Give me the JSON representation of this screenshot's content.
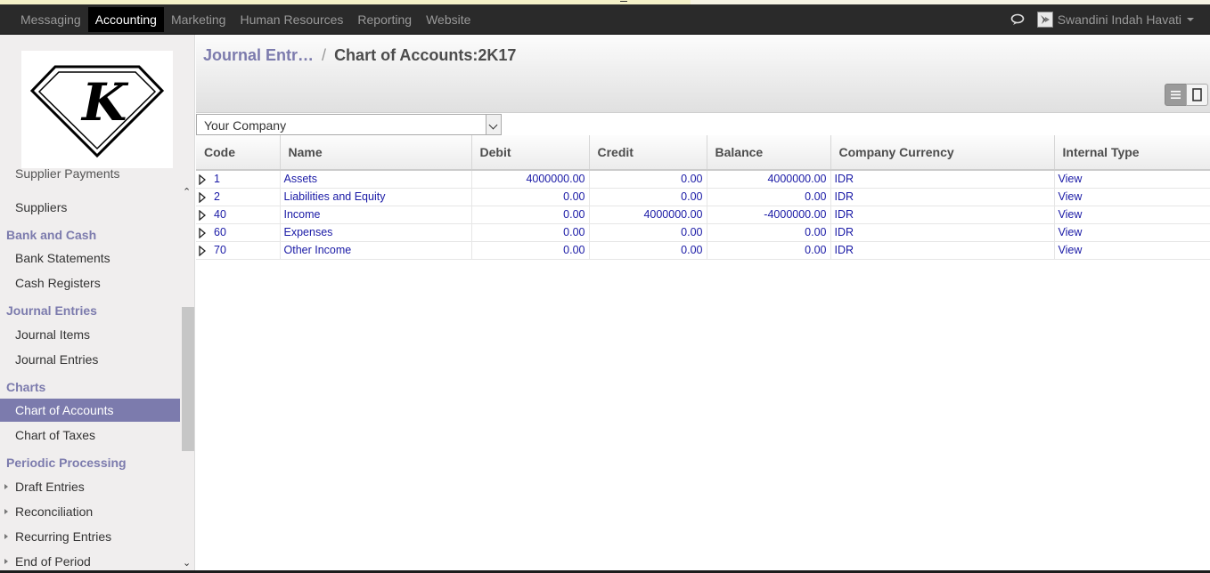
{
  "topmenu": [
    "Messaging",
    "Accounting",
    "Marketing",
    "Human Resources",
    "Reporting",
    "Website"
  ],
  "active_menu": "Accounting",
  "user": {
    "name": "Swandini Indah Havati"
  },
  "sidebar": {
    "partial_top": "Supplier Payments",
    "suppliers": "Suppliers",
    "bank_and_cash": "Bank and Cash",
    "bank_statements": "Bank Statements",
    "cash_registers": "Cash Registers",
    "journal_entries_cat": "Journal Entries",
    "journal_items": "Journal Items",
    "journal_entries": "Journal Entries",
    "charts": "Charts",
    "chart_of_accounts": "Chart of Accounts",
    "chart_of_taxes": "Chart of Taxes",
    "periodic_processing": "Periodic Processing",
    "draft_entries": "Draft Entries",
    "reconciliation": "Reconciliation",
    "recurring_entries": "Recurring Entries",
    "end_of_period": "End of Period"
  },
  "logo": {
    "letter": "K"
  },
  "breadcrumb": {
    "parent": "Journal Entr…",
    "separator": "/",
    "current": "Chart of Accounts:2K17"
  },
  "filter": {
    "company": "Your Company"
  },
  "table": {
    "columns": [
      "Code",
      "Name",
      "Debit",
      "Credit",
      "Balance",
      "Company Currency",
      "Internal Type"
    ],
    "rows": [
      {
        "code": "1",
        "name": "Assets",
        "debit": "4000000.00",
        "credit": "0.00",
        "balance": "4000000.00",
        "currency": "IDR",
        "type": "View"
      },
      {
        "code": "2",
        "name": "Liabilities and Equity",
        "debit": "0.00",
        "credit": "0.00",
        "balance": "0.00",
        "currency": "IDR",
        "type": "View"
      },
      {
        "code": "40",
        "name": "Income",
        "debit": "0.00",
        "credit": "4000000.00",
        "balance": "-4000000.00",
        "currency": "IDR",
        "type": "View"
      },
      {
        "code": "60",
        "name": "Expenses",
        "debit": "0.00",
        "credit": "0.00",
        "balance": "0.00",
        "currency": "IDR",
        "type": "View"
      },
      {
        "code": "70",
        "name": "Other Income",
        "debit": "0.00",
        "credit": "0.00",
        "balance": "0.00",
        "currency": "IDR",
        "type": "View"
      }
    ]
  },
  "colors": {
    "accent": "#7c7bad",
    "topbar": "#2a2a2a",
    "link": "#1a1aa6"
  }
}
